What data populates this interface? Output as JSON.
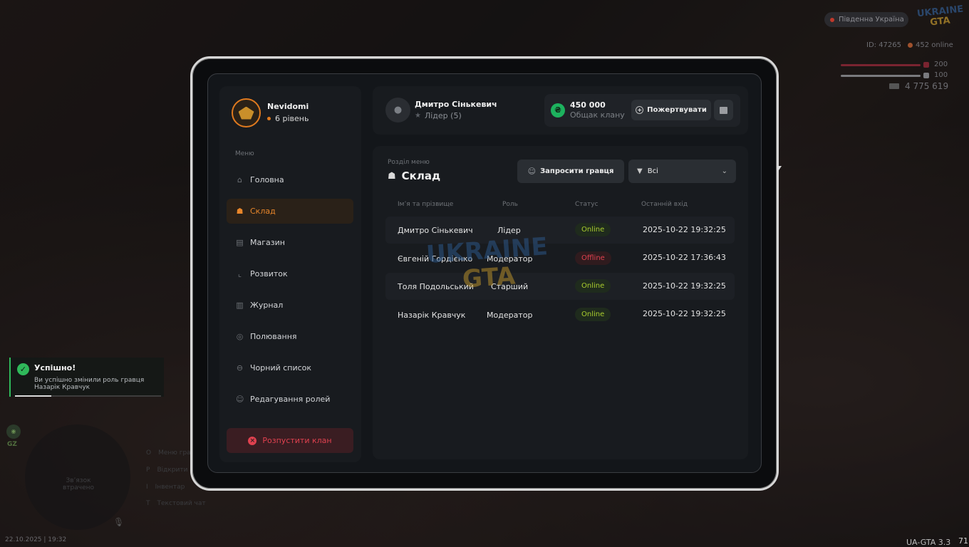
{
  "hud": {
    "server": "Південна Україна",
    "logo_top": "UKRAINE",
    "logo_bottom": "GTA",
    "player_id": "ID: 47265",
    "online": "452 online",
    "hp": "200",
    "armor": "100",
    "money": "4 775 619"
  },
  "profile": {
    "name": "Nevidomi",
    "level": "6 рівень"
  },
  "sidebar": {
    "caption": "Меню",
    "items": [
      {
        "label": "Головна",
        "icon": "home-icon"
      },
      {
        "label": "Склад",
        "icon": "group-icon",
        "active": true
      },
      {
        "label": "Магазин",
        "icon": "shop-icon"
      },
      {
        "label": "Розвиток",
        "icon": "chart-icon"
      },
      {
        "label": "Журнал",
        "icon": "book-icon"
      },
      {
        "label": "Полювання",
        "icon": "target-icon"
      },
      {
        "label": "Чорний список",
        "icon": "ban-icon"
      },
      {
        "label": "Редагування ролей",
        "icon": "user-edit-icon"
      }
    ],
    "disband": "Розпустити клан"
  },
  "header": {
    "user_name": "Дмитро Сінькевич",
    "user_role": "Лідер (5)",
    "treasury_amount": "450 000",
    "treasury_label": "Общак клану",
    "donate": "Пожертвувати",
    "coin_symbol": "₴"
  },
  "content": {
    "caption": "Розділ меню",
    "title": "Склад",
    "invite": "Запросити гравця",
    "filter": "Всі",
    "columns": [
      "Ім’я та прізвище",
      "Роль",
      "Статус",
      "Останній вхід"
    ],
    "rows": [
      {
        "name": "Дмитро Сінькевич",
        "role": "Лідер",
        "status": "Online",
        "last": "2025-10-22 19:32:25"
      },
      {
        "name": "Євгеній Гордієнко",
        "role": "Модератор",
        "status": "Offline",
        "last": "2025-10-22 17:36:43"
      },
      {
        "name": "Толя Подольський",
        "role": "Старший",
        "status": "Online",
        "last": "2025-10-22 19:32:25"
      },
      {
        "name": "Назарік Кравчук",
        "role": "Модератор",
        "status": "Online",
        "last": "2025-10-22 19:32:25"
      }
    ],
    "watermark_top": "UKRAINE",
    "watermark_bottom": "GTA"
  },
  "toast": {
    "title": "Успішно!",
    "text": "Ви успішно змінили роль гравця Назарік Кравчук",
    "progress": 0.25
  },
  "bottom_hud": {
    "gz": "GZ",
    "radar_text": "Зв’язок втрачено",
    "hints": [
      {
        "key": "O",
        "label": "Меню гра"
      },
      {
        "key": "P",
        "label": "Відкрити"
      },
      {
        "key": "I",
        "label": "Інвентар"
      },
      {
        "key": "T",
        "label": "Текстовий чат"
      }
    ],
    "datetime": "22.10.2025 | 19:32",
    "version": "UA-GTA 3.3",
    "fps": "71"
  },
  "colors": {
    "accent": "#e8862a",
    "online": "#a9cc2e",
    "offline": "#e0414f",
    "success": "#2fb85a"
  }
}
